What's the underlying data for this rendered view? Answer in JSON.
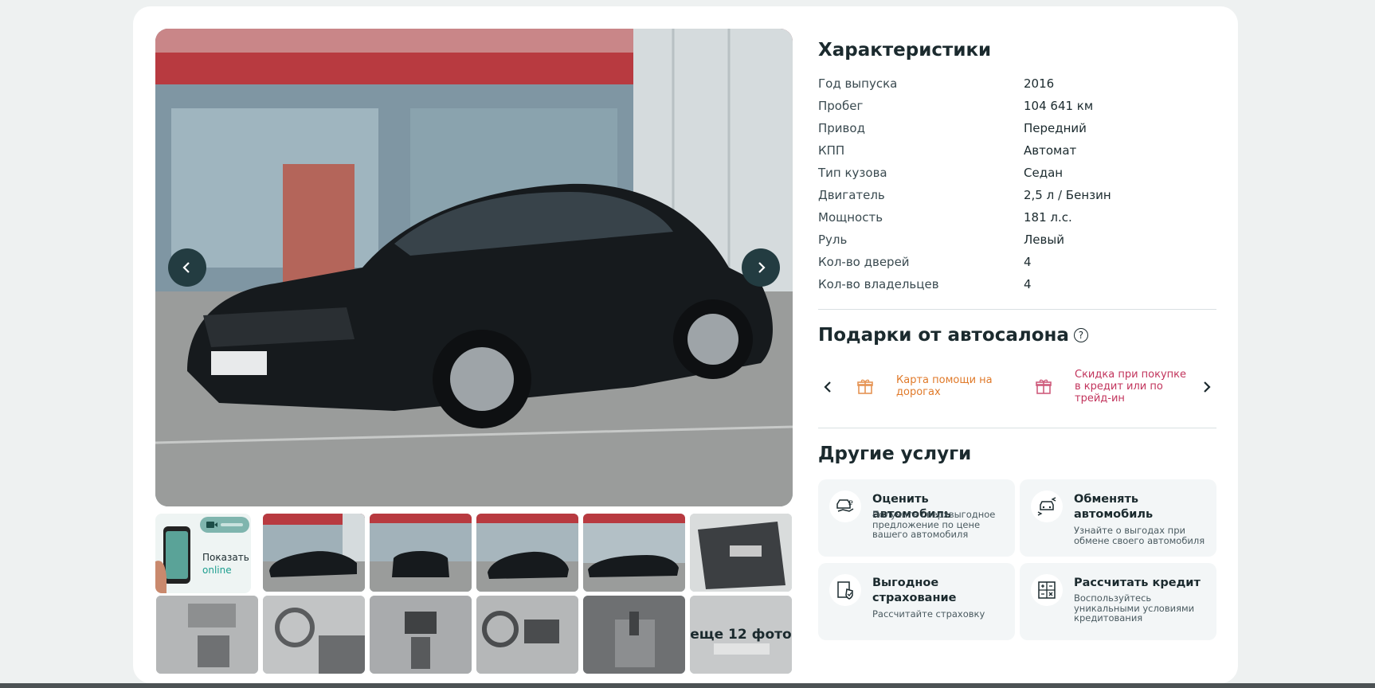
{
  "gallery": {
    "show_online_label": "Показать",
    "show_online_accent": "online",
    "more_photos": "еще 12 фото"
  },
  "specs": {
    "title": "Характеристики",
    "rows": [
      {
        "k": "Год выпуска",
        "v": "2016"
      },
      {
        "k": "Пробег",
        "v": "104 641 км"
      },
      {
        "k": "Привод",
        "v": "Передний"
      },
      {
        "k": "КПП",
        "v": "Автомат"
      },
      {
        "k": "Тип кузова",
        "v": "Седан"
      },
      {
        "k": "Двигатель",
        "v": "2,5 л / Бензин"
      },
      {
        "k": "Мощность",
        "v": "181 л.с."
      },
      {
        "k": "Руль",
        "v": "Левый"
      },
      {
        "k": "Кол-во дверей",
        "v": "4"
      },
      {
        "k": "Кол-во владельцев",
        "v": "4"
      }
    ]
  },
  "gifts": {
    "title": "Подарки от автосалона",
    "help_glyph": "?",
    "items": [
      {
        "text": "Карта помощи на дорогах",
        "bg": "#fcd9b6",
        "fg": "#e07a2a"
      },
      {
        "text": "Скидка при покупке в кредит или по трейд-ин",
        "bg": "#f7c7d0",
        "fg": "#c2345c"
      }
    ]
  },
  "services": {
    "title": "Другие услуги",
    "items": [
      {
        "title": "Оценить автомобиль",
        "desc": "Получите сверхвыгодное предложение по цене вашего автомобиля",
        "icon": "car-valuation-icon"
      },
      {
        "title": "Обменять автомобиль",
        "desc": "Узнайте о выгодах при обмене своего автомобиля",
        "icon": "car-exchange-icon"
      },
      {
        "title": "Выгодное страхование",
        "desc": "Рассчитайте страховку",
        "icon": "insurance-shield-icon"
      },
      {
        "title": "Рассчитать кредит",
        "desc": "Воспользуйтесь уникальными условиями кредитования",
        "icon": "calculator-icon"
      }
    ]
  },
  "colors": {
    "accent": "#1d9e8f",
    "arrow_bg": "#233c41"
  }
}
